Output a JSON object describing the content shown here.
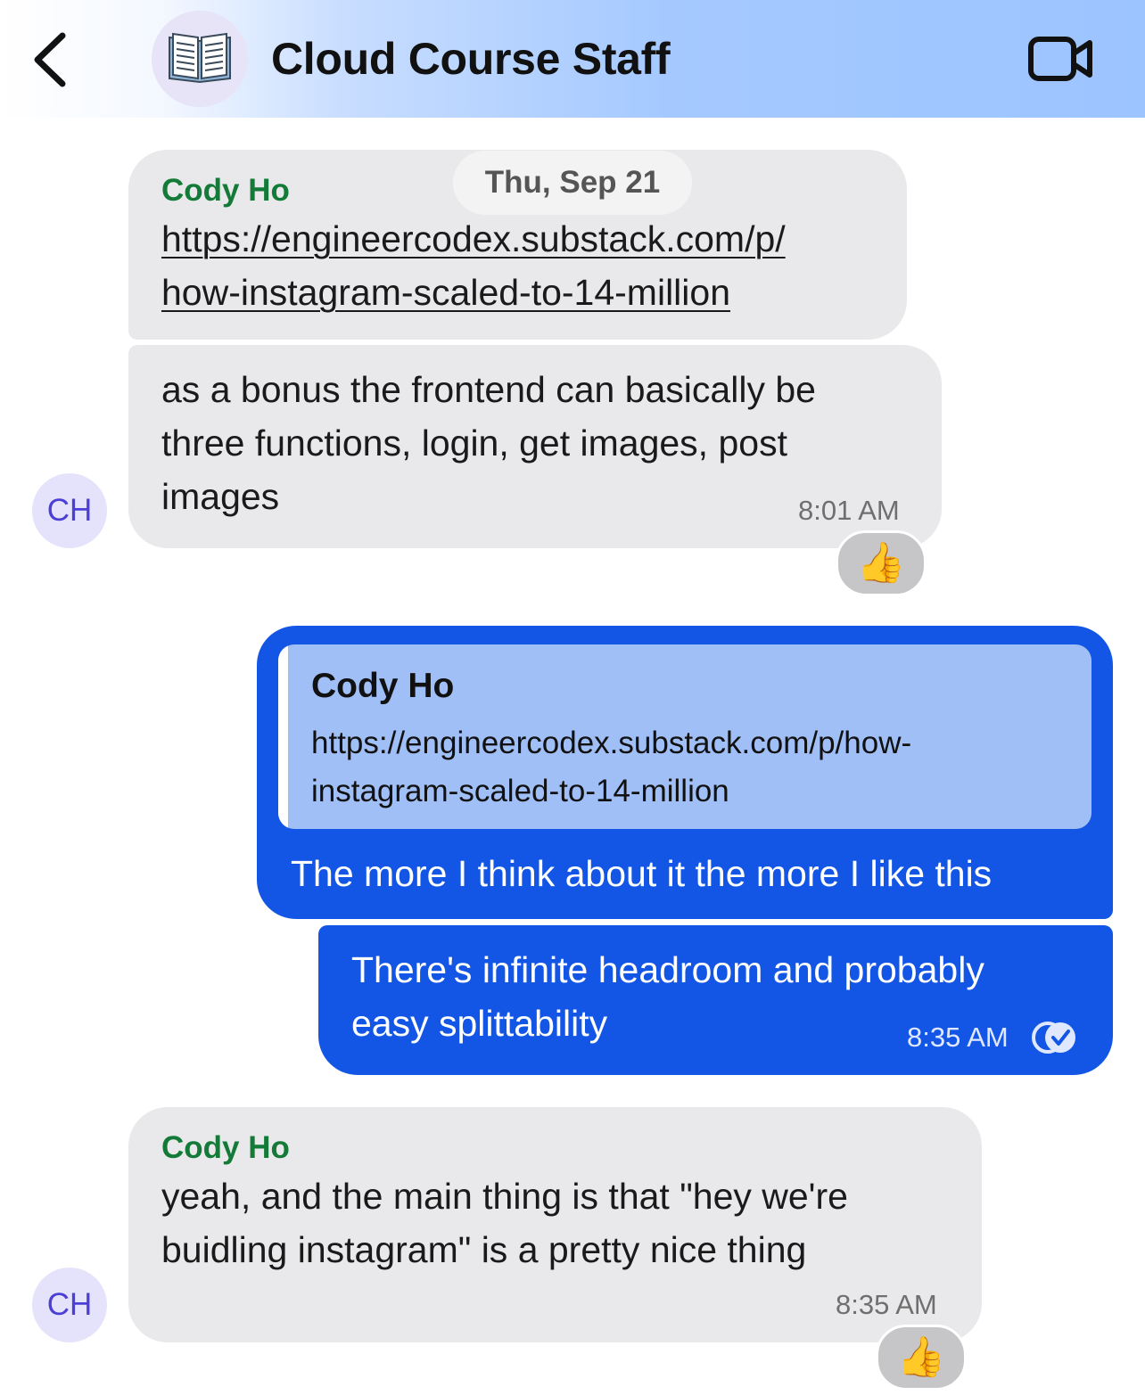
{
  "header": {
    "title": "Cloud Course Staff",
    "avatar_icon": "open-book-icon",
    "back_icon": "chevron-left-icon",
    "video_icon": "video-camera-icon"
  },
  "date_separator": "Thu, Sep 21",
  "messages": [
    {
      "sender": "Cody Ho",
      "link_line1": "https://engineercodex.substack.com/p/",
      "link_line2": "how-instagram-scaled-to-14-million"
    },
    {
      "line1": "as a bonus the frontend can basically be",
      "line2": "three functions, login, get images, post",
      "line3": "images",
      "time": "8:01 AM",
      "avatar": "CH",
      "reaction": "thumbs-up-icon"
    },
    {
      "quote_sender": "Cody Ho",
      "quote_line1": "https://engineercodex.substack.com/p/how-",
      "quote_line2": "instagram-scaled-to-14-million",
      "text": "The more I think about it the more I like this"
    },
    {
      "line1": "There's infinite headroom and probably",
      "line2": "easy splittability",
      "time": "8:35 AM",
      "status_icon": "read-receipt-check-icon"
    },
    {
      "sender": "Cody Ho",
      "line1": "yeah, and the main thing is that \"hey we're",
      "line2": "buidling instagram\" is a pretty nice thing",
      "time": "8:35 AM",
      "avatar": "CH",
      "reaction": "thumbs-up-icon"
    }
  ],
  "colors": {
    "outgoing_bubble": "#1356e6",
    "incoming_bubble": "#e9e9eb",
    "sender_name": "#137a38",
    "quote_background": "#a0bff6"
  }
}
